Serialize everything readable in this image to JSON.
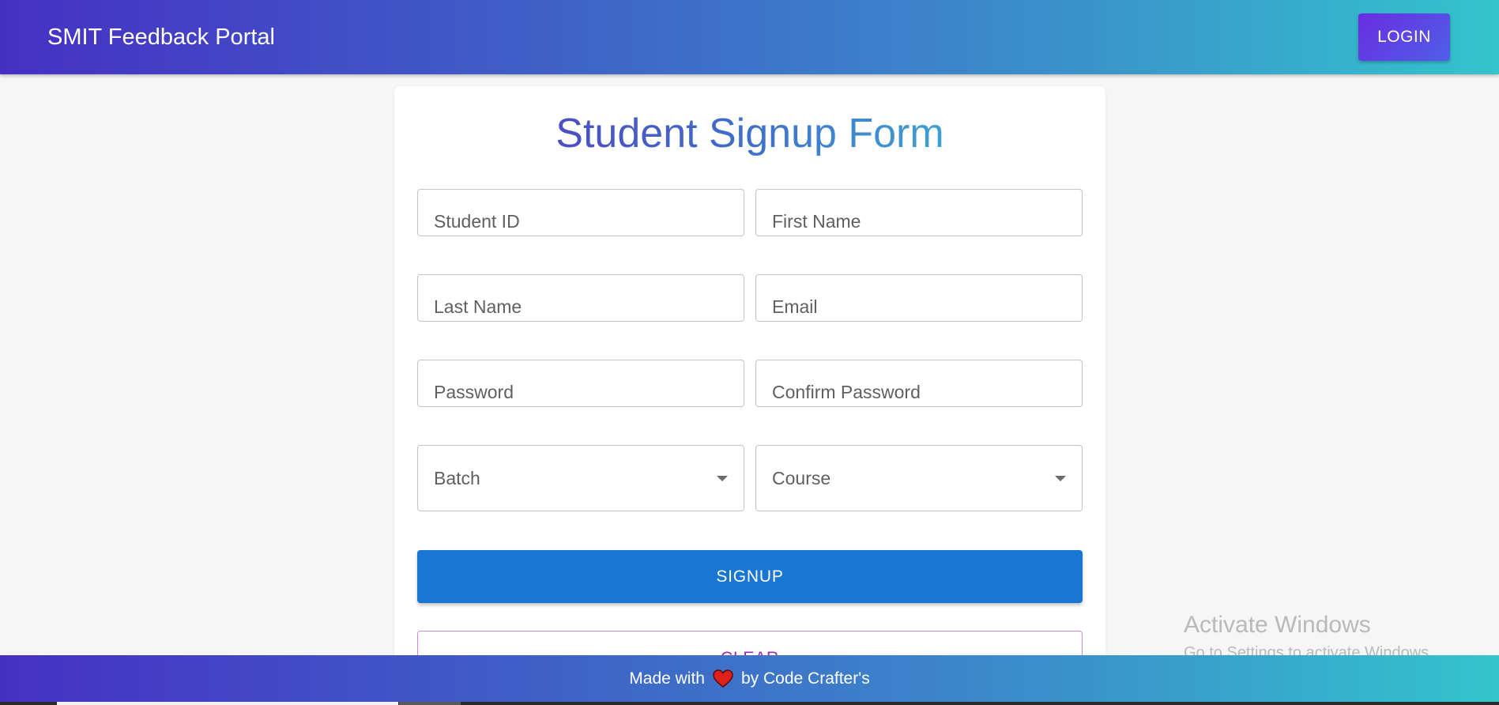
{
  "appbar": {
    "title": "SMIT Feedback Portal",
    "login_label": "LOGIN"
  },
  "form": {
    "title": "Student Signup Form",
    "fields": {
      "student_id": "Student ID",
      "first_name": "First Name",
      "last_name": "Last Name",
      "email": "Email",
      "password": "Password",
      "confirm_password": "Confirm Password"
    },
    "selects": {
      "batch": "Batch",
      "course": "Course"
    },
    "signup_label": "SIGNUP",
    "clear_label": "CLEAR"
  },
  "watermark": {
    "title": "Activate Windows",
    "subtitle": "Go to Settings to activate Windows."
  },
  "footer": {
    "prefix": "Made with",
    "icon": "heart-icon",
    "suffix": "by Code Crafter's"
  },
  "colors": {
    "gradient_start": "#4630c4",
    "gradient_end": "#33c4cc",
    "primary_button": "#1976d2",
    "clear_accent": "#9c27b0",
    "heart": "#e0201b"
  }
}
